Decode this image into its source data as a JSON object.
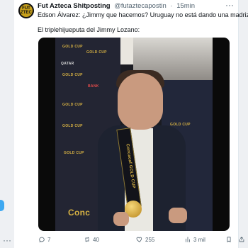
{
  "tweet": {
    "author": {
      "name": "Fut Azteca Shitposting",
      "handle": "@futaztecapostin",
      "time": "15min",
      "avatar_text": "FUT AZTECA"
    },
    "text": {
      "line1": "Edson Álvarez: ¿Jimmy que hacemos? Uruguay no está dando una madriza",
      "line2": "El triplehijueputa del Jimmy Lozano:"
    },
    "media": {
      "sponsors": [
        "GOLD CUP",
        "GOLD CUP",
        "QATAR",
        "GOLD CUP",
        "BANK",
        "GOLD CUP",
        "GOLD CUP",
        "GOLD CUP",
        "GOLD CUP"
      ],
      "lanyard_text": "Concacaf GOLD CUP",
      "bottom_text": "Conc"
    },
    "actions": {
      "replies": "7",
      "retweets": "40",
      "likes": "255",
      "views": "3 mil"
    }
  },
  "left": {
    "ellipsis": "···"
  }
}
